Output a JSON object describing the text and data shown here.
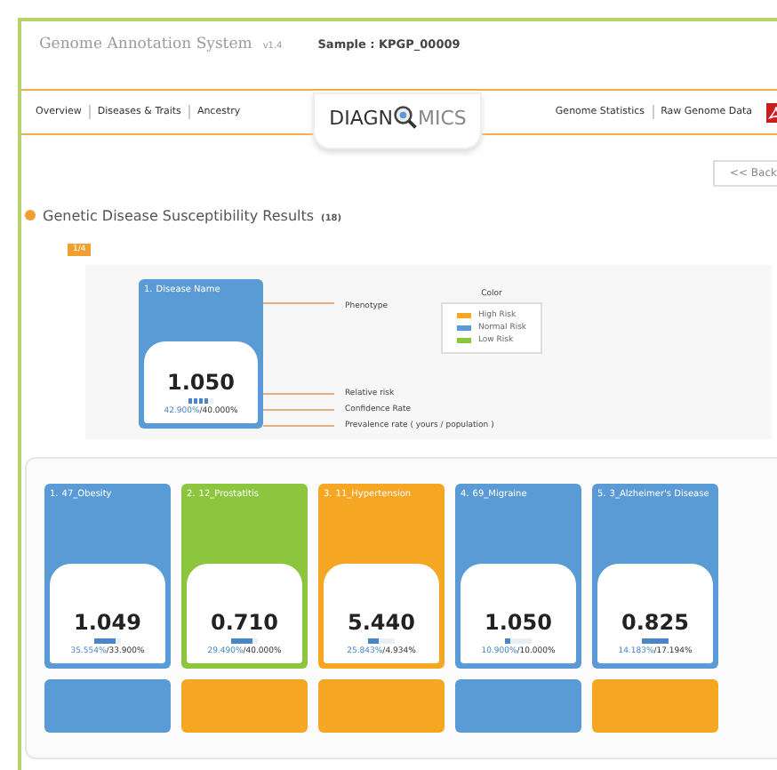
{
  "header": {
    "title": "Genome Annotation System",
    "version": "v1.4",
    "sample": "Sample : KPGP_00009"
  },
  "nav": {
    "left": [
      {
        "label": "Overview"
      },
      {
        "label": "Diseases & Traits"
      },
      {
        "label": "Ancestry"
      }
    ],
    "logo": {
      "left": "DIAGN",
      "right": "MICS"
    },
    "right": [
      {
        "label": "Genome Statistics"
      },
      {
        "label": "Raw Genome Data"
      }
    ]
  },
  "back_button": "<< Back",
  "section": {
    "title": "Genetic Disease Susceptibility Results",
    "count": "(18)"
  },
  "page_badge": "1/4",
  "legend": {
    "example": {
      "number": "1.",
      "name": "Disease Name",
      "color": "#5b9bd5",
      "value": "1.050",
      "stars": 4,
      "yours": "42.900%",
      "population": "/40.000%"
    },
    "callouts": [
      {
        "label": "Phenotype"
      },
      {
        "label": "Relative risk"
      },
      {
        "label": "Confidence Rate"
      },
      {
        "label": "Prevalence rate ( yours / population )"
      }
    ],
    "color_title": "Color",
    "colors": [
      {
        "label": "High Risk",
        "color": "#f5a623"
      },
      {
        "label": "Normal Risk",
        "color": "#5b9bd5"
      },
      {
        "label": "Low Risk",
        "color": "#8cc63f"
      }
    ]
  },
  "cards": [
    {
      "number": "1.",
      "name": "47_Obesity",
      "color": "#5b9bd5",
      "value": "1.049",
      "stars": 4,
      "yours": "35.554%",
      "population": "/33.900%"
    },
    {
      "number": "2.",
      "name": "12_Prostatitis",
      "color": "#8cc63f",
      "value": "0.710",
      "stars": 4,
      "yours": "29.490%",
      "population": "/40.000%"
    },
    {
      "number": "3.",
      "name": "11_Hypertension",
      "color": "#f5a623",
      "value": "5.440",
      "stars": 2,
      "yours": "25.843%",
      "population": "/4.934%"
    },
    {
      "number": "4.",
      "name": "69_Migraine",
      "color": "#5b9bd5",
      "value": "1.050",
      "stars": 1,
      "yours": "10.900%",
      "population": "/10.000%"
    },
    {
      "number": "5.",
      "name": "3_Alzheimer's Disease",
      "color": "#5b9bd5",
      "value": "0.825",
      "stars": 5,
      "yours": "14.183%",
      "population": "/17.194%"
    }
  ],
  "more_cards": [
    {
      "color": "#5b9bd5"
    },
    {
      "color": "#f5a623"
    },
    {
      "color": "#f5a623"
    },
    {
      "color": "#5b9bd5"
    },
    {
      "color": "#f5a623"
    }
  ]
}
